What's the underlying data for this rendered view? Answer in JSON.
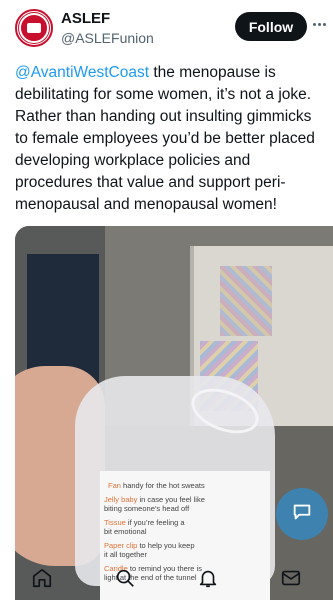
{
  "header": {
    "name": "ASLEF",
    "handle": "@ASLEFunion",
    "follow_label": "Follow"
  },
  "tweet": {
    "mention": "@AvantiWestCoast",
    "body": " the menopause is debilitating for some women, it’s not a joke. Rather than handing out insulting gimmicks to female employees you’d be better placed developing workplace policies and procedures that value and support peri-menopausal and menopausal women!"
  },
  "card": {
    "lines": [
      {
        "kw": "Fan",
        "rest": " handy for the hot sweats"
      },
      {
        "kw": "Jelly baby",
        "rest": " in case you feel like"
      },
      {
        "kw": "",
        "rest": "biting someone’s head off"
      },
      {
        "kw": "Tissue",
        "rest": " if you’re feeling a"
      },
      {
        "kw": "",
        "rest": "bit emotional"
      },
      {
        "kw": "Paper clip",
        "rest": " to help you keep"
      },
      {
        "kw": "",
        "rest": "it all together"
      },
      {
        "kw": "Candle",
        "rest": " to remind you there is"
      },
      {
        "kw": "",
        "rest": "light at the end of the tunnel"
      }
    ]
  },
  "icons": {
    "avatar": "aslef-logo",
    "more": "more-options-icon",
    "compose": "compose-icon",
    "nav": [
      "home-icon",
      "search-icon",
      "notifications-icon",
      "messages-icon"
    ]
  },
  "colors": {
    "mention": "#1d9bf0",
    "follow_bg": "#0f1419",
    "logo_red": "#c8102e",
    "card_keyword": "#e2733a"
  }
}
